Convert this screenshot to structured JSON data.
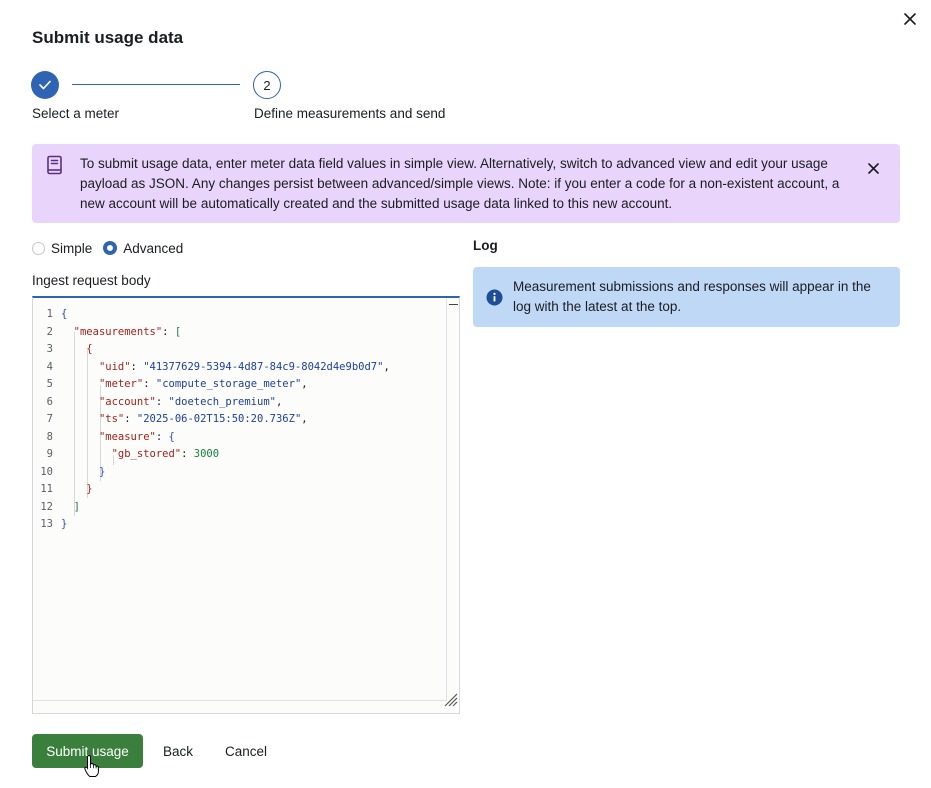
{
  "modal": {
    "title": "Submit usage data"
  },
  "stepper": {
    "step1_label": "Select a meter",
    "step2_number": "2",
    "step2_label": "Define measurements and send"
  },
  "banner": {
    "text": "To submit usage data, enter meter data field values in simple view. Alternatively, switch to advanced view and edit your usage payload as JSON. Any changes persist between advanced/simple views. Note: if you enter a code for a non-existent account, a new account will be automatically created and the submitted usage data linked to this new account.",
    "icon": "book-icon"
  },
  "view_toggle": {
    "simple_label": "Simple",
    "advanced_label": "Advanced",
    "selected": "Advanced"
  },
  "editor": {
    "label": "Ingest request body",
    "line_numbers": [
      "1",
      "2",
      "3",
      "4",
      "5",
      "6",
      "7",
      "8",
      "9",
      "10",
      "11",
      "12",
      "13"
    ],
    "json": {
      "uid": "41377629-5394-4d87-84c9-8042d4e9b0d7",
      "meter": "compute_storage_meter",
      "account": "doetech_premium",
      "ts": "2025-06-02T15:50:20.736Z",
      "gb_stored": "3000"
    },
    "keys": {
      "measurements": "\"measurements\"",
      "uid": "\"uid\"",
      "meter": "\"meter\"",
      "account": "\"account\"",
      "ts": "\"ts\"",
      "measure": "\"measure\"",
      "gb_stored": "\"gb_stored\""
    }
  },
  "log": {
    "title": "Log",
    "info_text": "Measurement submissions and responses will appear in the log with the latest at the top."
  },
  "footer": {
    "submit_label": "Submit usage",
    "back_label": "Back",
    "cancel_label": "Cancel"
  },
  "colors": {
    "primary": "#2f63b4",
    "submit": "#3b7f3c",
    "banner_bg": "#e9d5fb",
    "info_bg": "#bfd8f5"
  }
}
